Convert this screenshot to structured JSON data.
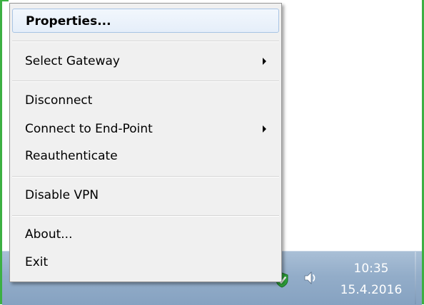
{
  "context_menu": {
    "items": [
      {
        "label": "Properties...",
        "default": true,
        "submenu": false
      },
      {
        "label": "Select Gateway",
        "default": false,
        "submenu": true
      },
      {
        "label": "Disconnect",
        "default": false,
        "submenu": false
      },
      {
        "label": "Connect to End-Point",
        "default": false,
        "submenu": true
      },
      {
        "label": "Reauthenticate",
        "default": false,
        "submenu": false
      },
      {
        "label": "Disable VPN",
        "default": false,
        "submenu": false
      },
      {
        "label": "About...",
        "default": false,
        "submenu": false
      },
      {
        "label": "Exit",
        "default": false,
        "submenu": false
      }
    ]
  },
  "taskbar": {
    "tray_icons": [
      "vpn-shield-check-icon",
      "speaker-volume-icon"
    ],
    "clock": {
      "time": "10:35",
      "date": "15.4.2016"
    }
  },
  "colors": {
    "frame_border": "#3cb043",
    "vpn_icon_green": "#2fa33a",
    "taskbar": "#93adc9",
    "menu_background": "#f0f0f0",
    "highlight_border": "#a8c4e4"
  }
}
